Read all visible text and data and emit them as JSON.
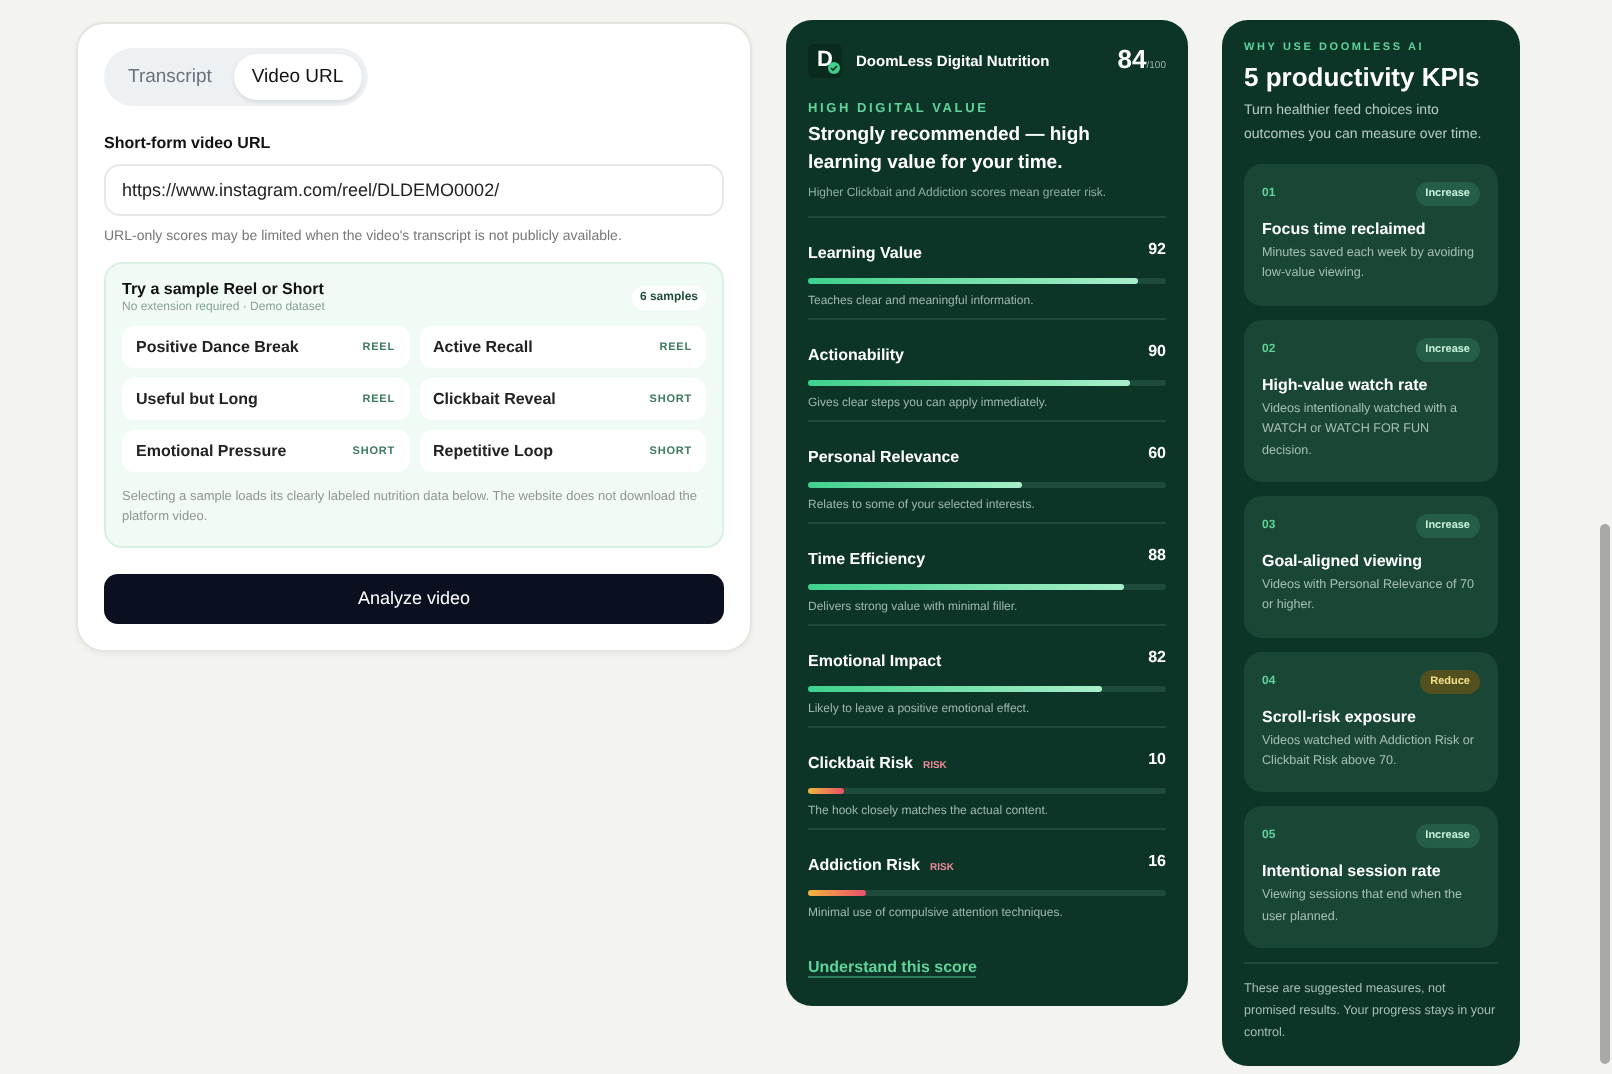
{
  "input_card": {
    "tabs": [
      {
        "label": "Transcript",
        "selected": false
      },
      {
        "label": "Video URL",
        "selected": true
      }
    ],
    "url_label": "Short-form video URL",
    "url_value": "https://www.instagram.com/reel/DLDEMO0002/",
    "url_note": "URL-only scores may be limited when the video's transcript is not publicly available.",
    "samples": {
      "title": "Try a sample Reel or Short",
      "subtitle": "No extension required · Demo dataset",
      "count": "6 samples",
      "items": [
        {
          "name": "Positive Dance Break",
          "format": "REEL"
        },
        {
          "name": "Active Recall",
          "format": "REEL"
        },
        {
          "name": "Useful but Long",
          "format": "REEL"
        },
        {
          "name": "Clickbait Reveal",
          "format": "SHORT"
        },
        {
          "name": "Emotional Pressure",
          "format": "SHORT"
        },
        {
          "name": "Repetitive Loop",
          "format": "SHORT"
        }
      ],
      "note": "Selecting a sample loads its clearly labeled nutrition data below. The website does not download the platform video."
    },
    "button": "Analyze video"
  },
  "nutrition": {
    "logo": "D",
    "title": "DoomLess Digital Nutrition",
    "score": "84",
    "score_max": "/100",
    "verdict_label": "HIGH DIGITAL VALUE",
    "verdict": "Strongly recommended — high learning value for your time.",
    "hint": "Higher Clickbait and Addiction scores mean greater risk.",
    "metrics": [
      {
        "kind": "benefit",
        "name": "Learning Value",
        "value": "92",
        "level": 0.92,
        "desc": "Teaches clear and meaningful information."
      },
      {
        "kind": "benefit",
        "name": "Actionability",
        "value": "90",
        "level": 0.9,
        "desc": "Gives clear steps you can apply immediately."
      },
      {
        "kind": "benefit",
        "name": "Personal Relevance",
        "value": "60",
        "level": 0.6,
        "desc": "Relates to some of your selected interests."
      },
      {
        "kind": "benefit",
        "name": "Time Efficiency",
        "value": "88",
        "level": 0.88,
        "desc": "Delivers strong value with minimal filler."
      },
      {
        "kind": "benefit",
        "name": "Emotional Impact",
        "value": "82",
        "level": 0.82,
        "desc": "Likely to leave a positive emotional effect."
      },
      {
        "kind": "risk",
        "name": "Clickbait Risk",
        "tag": "RISK",
        "value": "10",
        "level": 0.1,
        "desc": "The hook closely matches the actual content."
      },
      {
        "kind": "risk",
        "name": "Addiction Risk",
        "tag": "RISK",
        "value": "16",
        "level": 0.16,
        "desc": "Minimal use of compulsive attention techniques."
      }
    ],
    "link": "Understand this score"
  },
  "kpis": {
    "eyebrow": "WHY USE DOOMLESS AI",
    "title": "5 productivity KPIs",
    "intro": "Turn healthier feed choices into outcomes you can measure over time.",
    "items": [
      {
        "number": "01",
        "kind": "increase",
        "tag": "Increase",
        "title": "Focus time reclaimed",
        "desc": "Minutes saved each week by avoiding low-value viewing."
      },
      {
        "number": "02",
        "kind": "increase",
        "tag": "Increase",
        "title": "High-value watch rate",
        "desc": "Videos intentionally watched with a WATCH or WATCH FOR FUN decision."
      },
      {
        "number": "03",
        "kind": "increase",
        "tag": "Increase",
        "title": "Goal-aligned viewing",
        "desc": "Videos with Personal Relevance of 70 or higher."
      },
      {
        "number": "04",
        "kind": "reduce",
        "tag": "Reduce",
        "title": "Scroll-risk exposure",
        "desc": "Videos watched with Addiction Risk or Clickbait Risk above 70."
      },
      {
        "number": "05",
        "kind": "increase",
        "tag": "Increase",
        "title": "Intentional session rate",
        "desc": "Viewing sessions that end when the user planned."
      }
    ],
    "footer": "These are suggested measures, not promised results. Your progress stays in your control."
  }
}
